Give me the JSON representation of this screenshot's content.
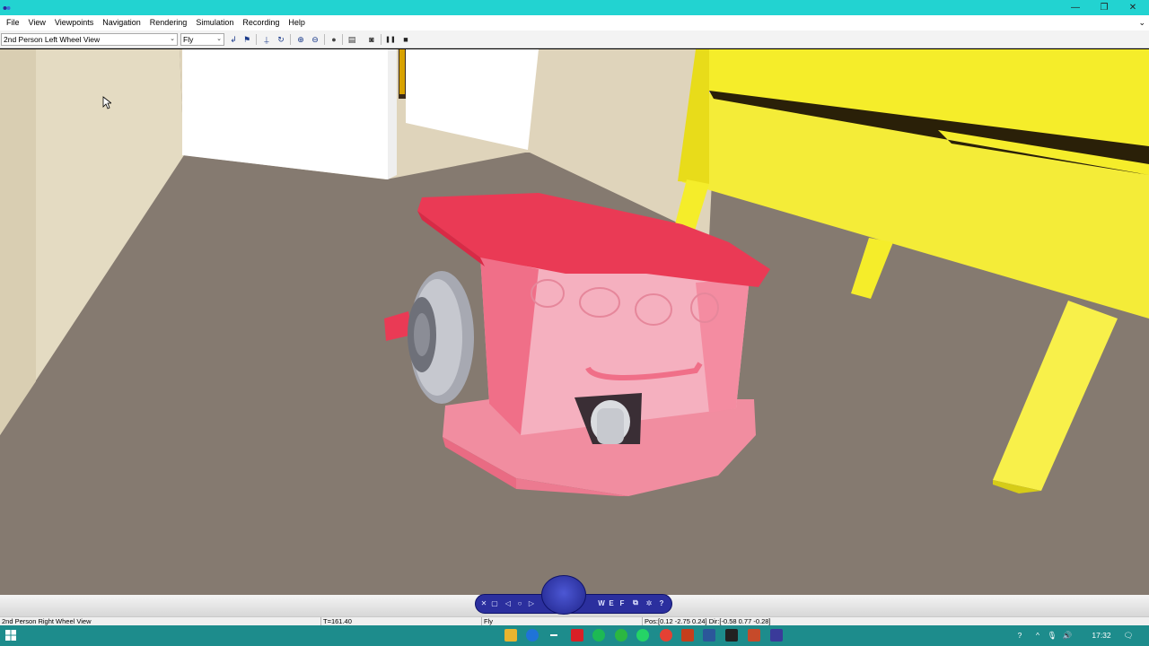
{
  "window": {
    "minimize_glyph": "—",
    "maximize_glyph": "❐",
    "close_glyph": "✕"
  },
  "menu": {
    "items": [
      "File",
      "View",
      "Viewpoints",
      "Navigation",
      "Rendering",
      "Simulation",
      "Recording",
      "Help"
    ],
    "right_glyph": "⌄"
  },
  "toolbar": {
    "viewpoint_select": "2nd Person Left Wheel View",
    "navigation_mode_select": "Fly",
    "combo_arrow": "⌄",
    "buttons": [
      {
        "icon": "return-arrow-icon",
        "glyph": "↲"
      },
      {
        "icon": "flag-icon",
        "glyph": "⚑"
      },
      {
        "icon": "lift-icon",
        "glyph": "⍊"
      },
      {
        "icon": "rotate-icon",
        "glyph": "↻"
      },
      {
        "icon": "zoom-in-icon",
        "glyph": "⊕"
      },
      {
        "icon": "zoom-out-icon",
        "glyph": "⊖"
      },
      {
        "icon": "record-icon",
        "glyph": "●"
      },
      {
        "icon": "clipboard-icon",
        "glyph": "▤"
      },
      {
        "icon": "camera-icon",
        "glyph": "◙"
      },
      {
        "icon": "pause-icon",
        "glyph": "❚❚"
      },
      {
        "icon": "stop-icon",
        "glyph": "■"
      }
    ]
  },
  "nav_controls": {
    "left_glyphs": [
      "✕",
      "▢",
      "◁",
      "○",
      "▷"
    ],
    "right_glyphs": [
      "W",
      "E",
      "F",
      "⧉",
      "✲",
      "?"
    ]
  },
  "status": {
    "viewpoint": "2nd Person Right Wheel View",
    "time": "T=161.40",
    "mode": "Fly",
    "position": "Pos:[0.12 -2.75 0.24] Dir:[-0.58 0.77 -0.28]"
  },
  "taskbar": {
    "tray_help": "?",
    "tray_chevron": "^",
    "tray_mic": "🎙",
    "tray_volume": "🔊",
    "clock": "17:32",
    "notifications": "🗨"
  },
  "colors": {
    "titlebar": "#22d3d1",
    "taskbar": "#1d8c8c",
    "robot_body": "#ea3a55",
    "floor": "#857a70",
    "furniture": "#f2ea2a"
  }
}
